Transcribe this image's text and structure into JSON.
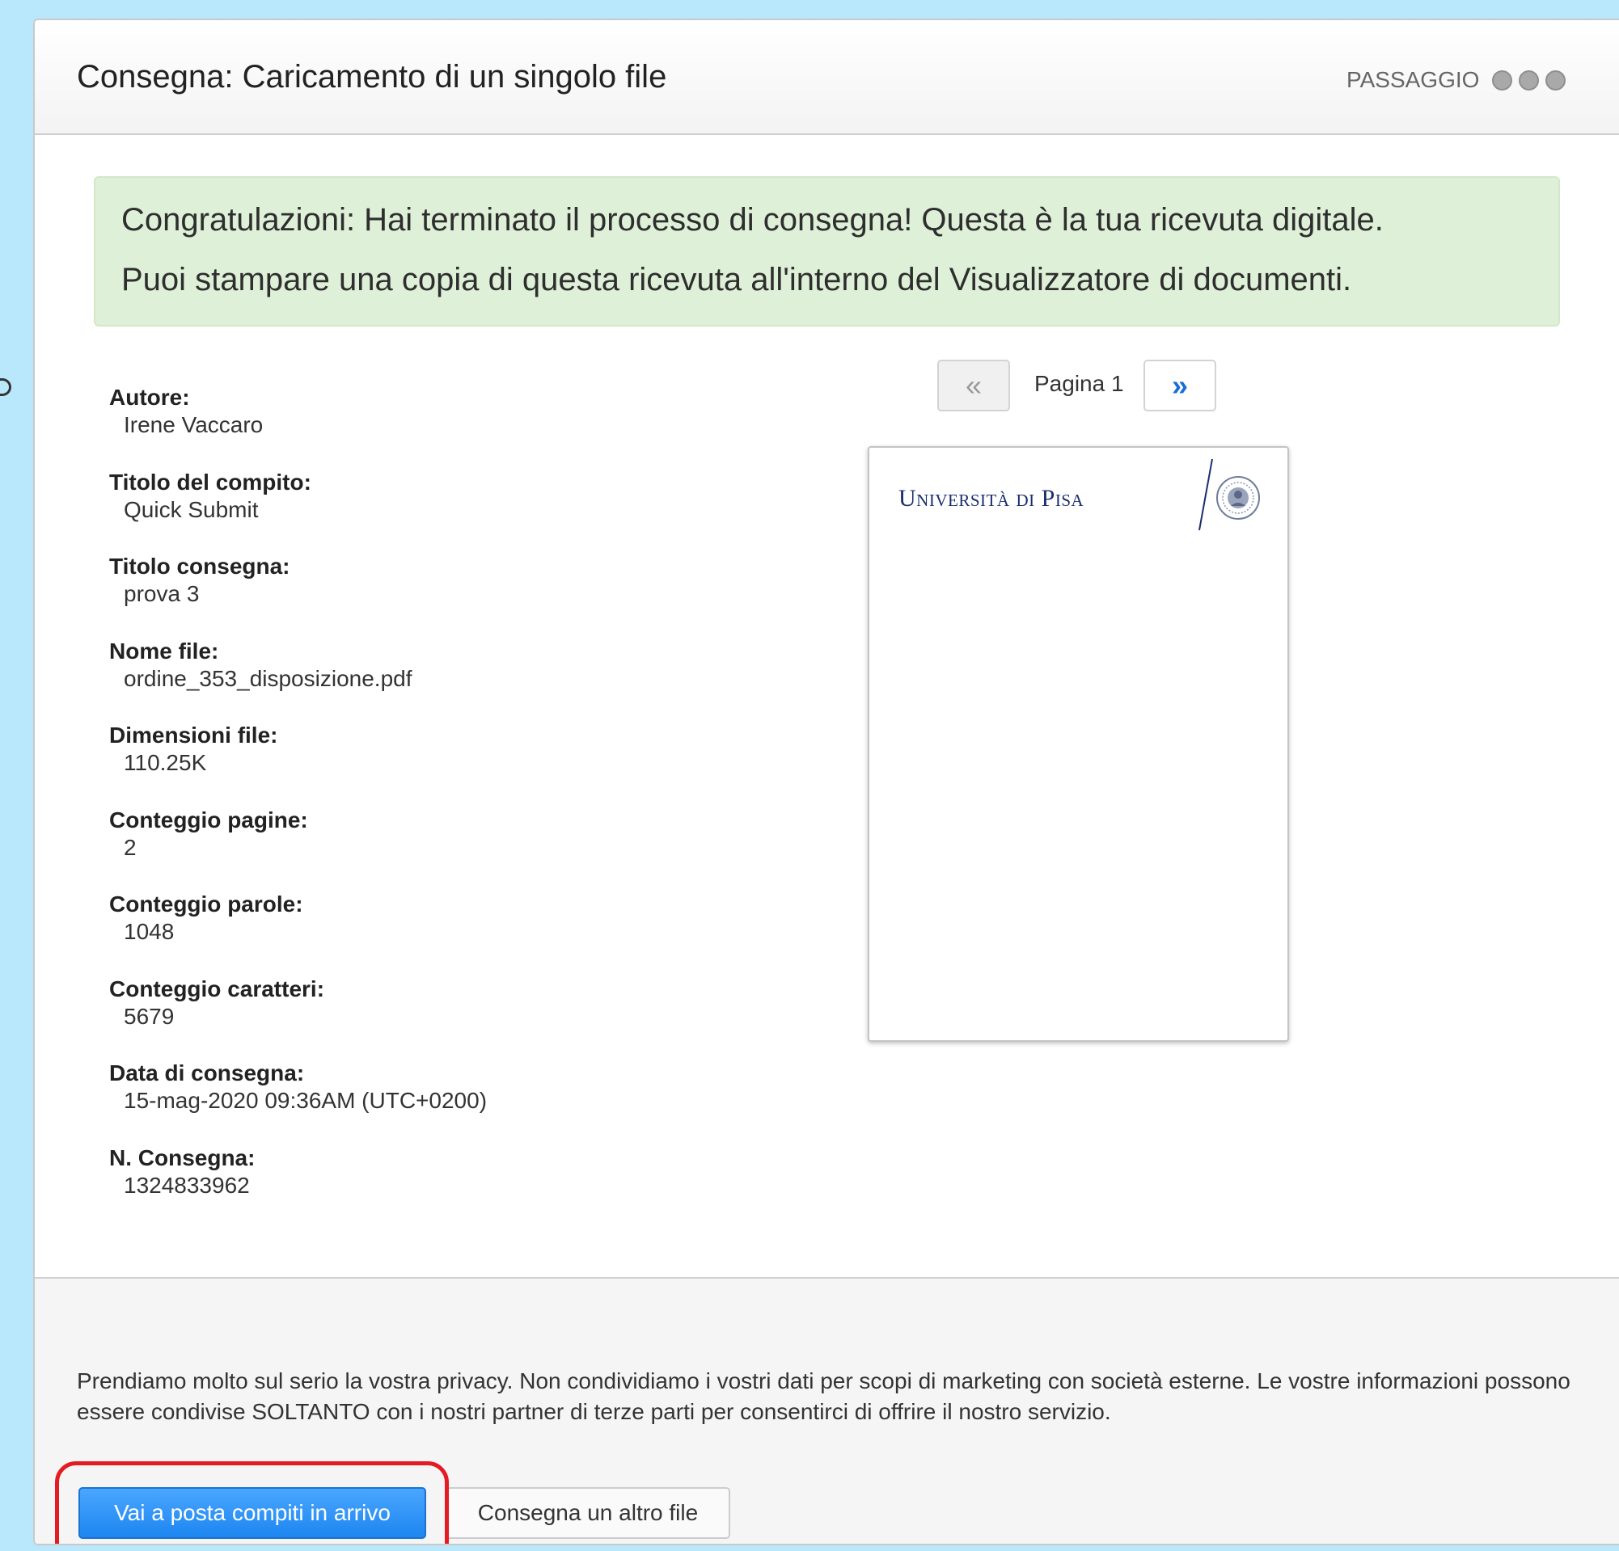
{
  "header": {
    "title": "Consegna: Caricamento di un singolo file",
    "step_label": "PASSAGGIO"
  },
  "alert": {
    "line1": "Congratulazioni: Hai terminato il processo di consegna! Questa è la tua ricevuta digitale.",
    "line2": "Puoi stampare una copia di questa ricevuta all'interno del Visualizzatore di documenti."
  },
  "receipt": {
    "items": [
      {
        "label": "Autore:",
        "value": "Irene Vaccaro"
      },
      {
        "label": "Titolo del compito:",
        "value": "Quick Submit"
      },
      {
        "label": "Titolo consegna:",
        "value": "prova 3"
      },
      {
        "label": "Nome file:",
        "value": "ordine_353_disposizione.pdf"
      },
      {
        "label": "Dimensioni file:",
        "value": "110.25K"
      },
      {
        "label": "Conteggio pagine:",
        "value": "2"
      },
      {
        "label": "Conteggio parole:",
        "value": "1048"
      },
      {
        "label": "Conteggio caratteri:",
        "value": "5679"
      },
      {
        "label": "Data di consegna:",
        "value": "15-mag-2020 09:36AM (UTC+0200)"
      },
      {
        "label": "N. Consegna:",
        "value": "1324833962"
      }
    ]
  },
  "viewer": {
    "prev_icon": "«",
    "next_icon": "»",
    "page_label": "Pagina 1",
    "doc_logo_text": "Università di Pisa",
    "brand_color": "#1a2d6e"
  },
  "footer": {
    "privacy_text": "Prendiamo molto sul serio la vostra privacy. Non condividiamo i vostri dati per scopi di marketing con società esterne. Le vostre informazioni possono essere condivise SOLTANTO con i nostri partner di terze parti per consentirci di offrire il nostro servizio.",
    "primary_button": "Vai a posta compiti in arrivo",
    "secondary_button": "Consegna un altro file"
  },
  "colors": {
    "primary_button": "#1d86f0",
    "success_background": "#dff0d8",
    "highlight": "#e51b24",
    "page_background": "#b9e7fb"
  }
}
